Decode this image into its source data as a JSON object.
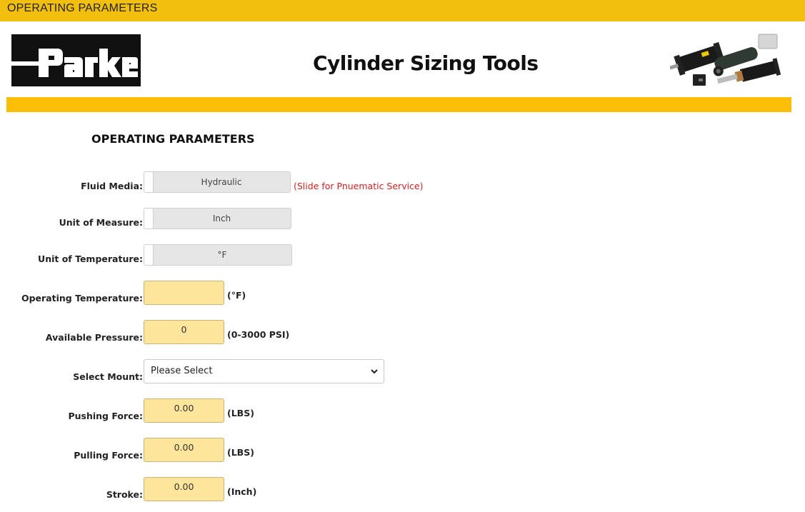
{
  "window": {
    "title": "OPERATING PARAMETERS"
  },
  "header": {
    "logo_text": "Parker",
    "site_title": "Cylinder Sizing Tools",
    "product_image_alt": "hydraulic-cylinders"
  },
  "colors": {
    "topbar": "#f2bf0f",
    "accent_bar": "#fcbe06",
    "input_fill": "#fde59c",
    "hint_red": "#cc2222"
  },
  "form": {
    "section_title": "OPERATING PARAMETERS",
    "fluid_media": {
      "label": "Fluid Media:",
      "value": "Hydraulic",
      "hint": "(Slide for Pnuematic Service)"
    },
    "unit_of_measure": {
      "label": "Unit of Measure:",
      "value": "Inch"
    },
    "unit_of_temperature": {
      "label": "Unit of Temperature:",
      "value": "°F"
    },
    "operating_temperature": {
      "label": "Operating Temperature:",
      "value": "",
      "unit": "(°F)"
    },
    "available_pressure": {
      "label": "Available Pressure:",
      "value": "0",
      "unit": "(0-3000 PSI)"
    },
    "select_mount": {
      "label": "Select Mount:",
      "selected": "Please Select"
    },
    "pushing_force": {
      "label": "Pushing Force:",
      "value": "0.00",
      "unit": "(LBS)"
    },
    "pulling_force": {
      "label": "Pulling Force:",
      "value": "0.00",
      "unit": "(LBS)"
    },
    "stroke": {
      "label": "Stroke:",
      "value": "0.00",
      "unit": "(Inch)"
    }
  }
}
